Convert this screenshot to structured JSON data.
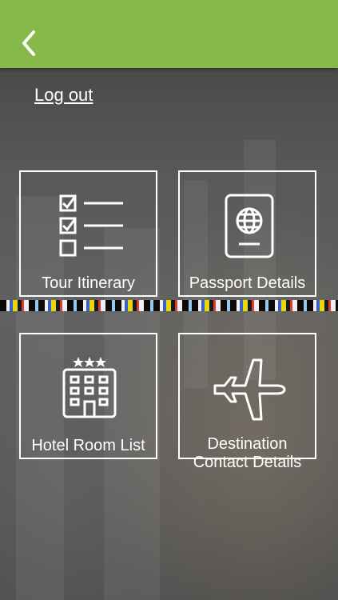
{
  "header": {
    "back_icon": "chevron-left-icon",
    "bar_color": "#86b84a"
  },
  "account": {
    "logout_label": "Log out"
  },
  "tiles": [
    {
      "label": "Tour Itinerary",
      "icon": "checklist-icon"
    },
    {
      "label": "Passport Details",
      "icon": "passport-icon"
    },
    {
      "label": "Hotel Room List",
      "icon": "hotel-building-icon"
    },
    {
      "label_line1": "Destination",
      "label_line2": "Contact Details",
      "icon": "airplane-icon"
    }
  ]
}
